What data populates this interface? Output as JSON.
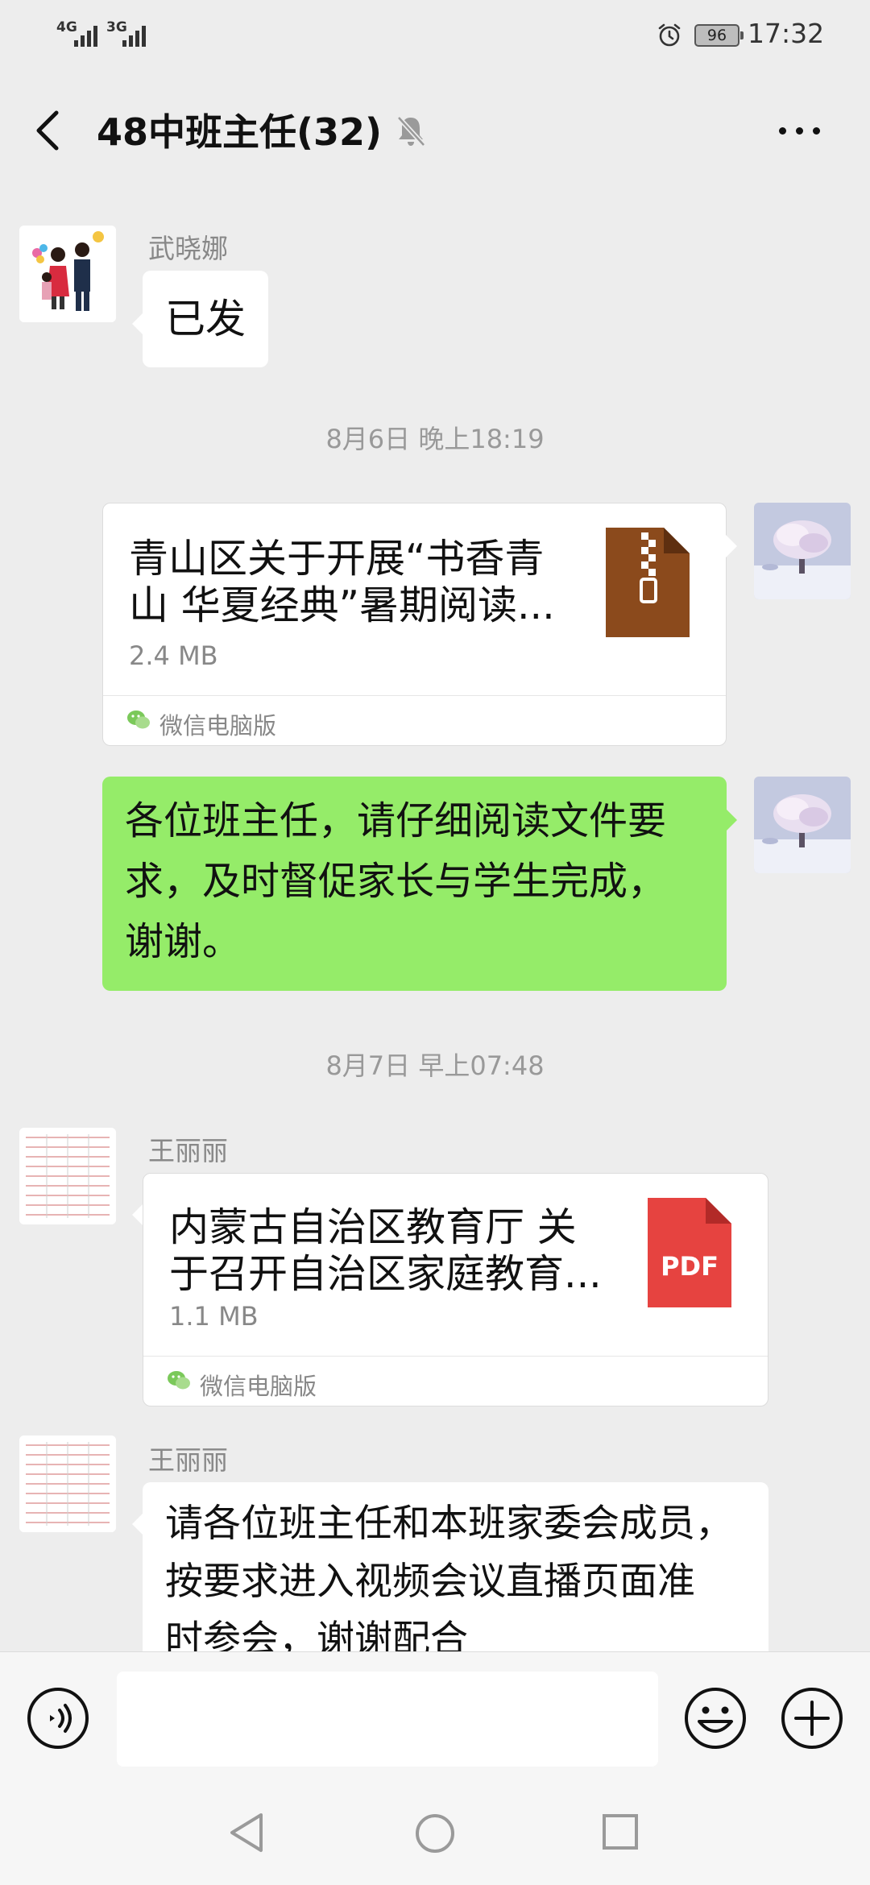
{
  "status_bar": {
    "network_1": "4G",
    "network_2": "3G",
    "battery": "96",
    "time": "17:32"
  },
  "header": {
    "title": "48中班主任(32)",
    "icons": [
      "back-arrow-icon",
      "mute-bell-icon",
      "more-icon"
    ]
  },
  "messages": [
    {
      "type": "text",
      "sender": "武晓娜",
      "side": "left",
      "text": "已发"
    },
    {
      "type": "timestamp",
      "text": "8月6日 晚上18:19"
    },
    {
      "type": "file",
      "side": "right",
      "name_line1": "青山区关于开展“书香青",
      "name_line2": "山 华夏经典”暑期阅读...",
      "size": "2.4 MB",
      "file_icon": "zip-file-icon",
      "source": "微信电脑版"
    },
    {
      "type": "text",
      "side": "right",
      "line1": "各位班主任，请仔细阅读文件要",
      "line2": "求，及时督促家长与学生完成，",
      "line3": "谢谢。"
    },
    {
      "type": "timestamp",
      "text": "8月7日 早上07:48"
    },
    {
      "type": "file",
      "sender": "王丽丽",
      "side": "left",
      "name_line1": "内蒙古自治区教育厅 关",
      "name_line2": "于召开自治区家庭教育...",
      "size": "1.1 MB",
      "file_icon": "pdf-file-icon",
      "file_icon_label": "PDF",
      "source": "微信电脑版"
    },
    {
      "type": "text",
      "sender": "王丽丽",
      "side": "left",
      "line1": "请各位班主任和本班家委会成员，",
      "line2": "按要求进入视频会议直播页面准",
      "line3": "时参会，谢谢配合"
    }
  ],
  "colors": {
    "chat_bg": "#ededed",
    "own_bubble": "#95ec69",
    "other_bubble": "#ffffff",
    "zip_icon": "#8b4a1c",
    "pdf_icon": "#e64340"
  },
  "input_bar": {
    "icons": [
      "voice-icon",
      "emoji-icon",
      "plus-icon"
    ]
  },
  "nav_bar": {
    "icons": [
      "nav-back-icon",
      "nav-home-icon",
      "nav-recent-icon"
    ]
  }
}
